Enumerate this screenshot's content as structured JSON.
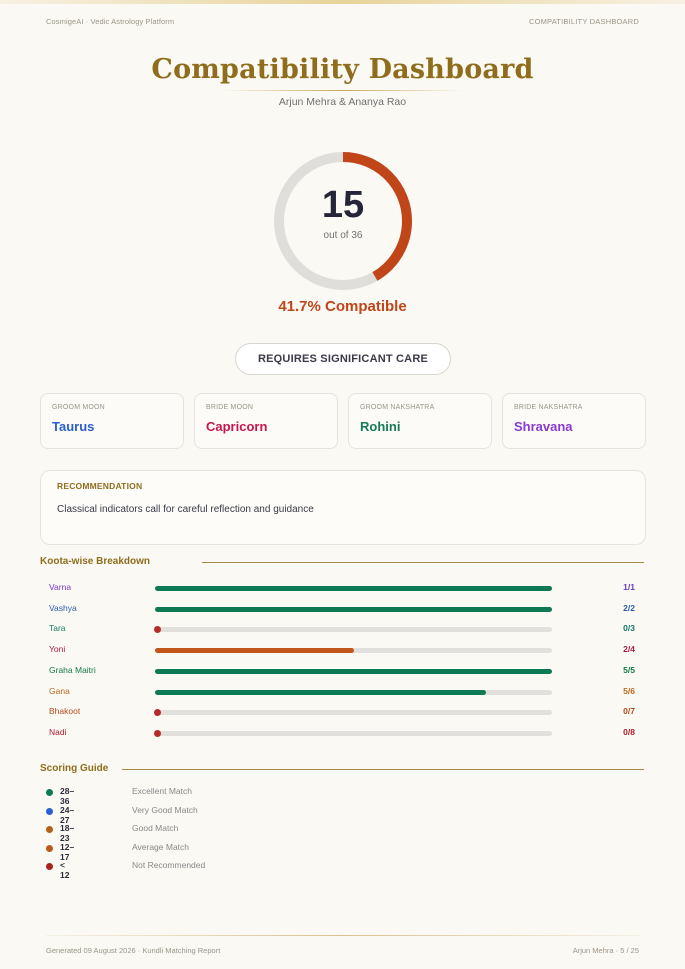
{
  "header": {
    "left": "CosmigeAI  ·  Vedic Astrology Platform",
    "right": "COMPATIBILITY DASHBOARD"
  },
  "title": "Compatibility Dashboard",
  "couple": "Arjun Mehra  &  Ananya Rao",
  "score": {
    "value": "15",
    "out_of": "out of 36",
    "fraction": 0.4167,
    "percent_label": "41.7% Compatible",
    "color": "#c0461a"
  },
  "verdict": "REQUIRES SIGNIFICANT CARE",
  "cards": [
    {
      "label": "GROOM MOON",
      "value": "Taurus",
      "color": "#2a5fd0"
    },
    {
      "label": "BRIDE MOON",
      "value": "Capricorn",
      "color": "#c8144e"
    },
    {
      "label": "GROOM NAKSHATRA",
      "value": "Rohini",
      "color": "#157a5a"
    },
    {
      "label": "BRIDE NAKSHATRA",
      "value": "Shravana",
      "color": "#8a3ad0"
    }
  ],
  "recommendation": {
    "label": "RECOMMENDATION",
    "text": "Classical indicators call for careful reflection and guidance"
  },
  "koota": {
    "title": "Koota-wise Breakdown",
    "rows": [
      {
        "name": "Varna",
        "score": "1/1",
        "fraction": 1.0,
        "name_color": "#7a3ad0",
        "score_color": "#6a3ac8",
        "bar_color": "#0d7a55"
      },
      {
        "name": "Vashya",
        "score": "2/2",
        "fraction": 1.0,
        "name_color": "#2a5fb0",
        "score_color": "#2a5fb0",
        "bar_color": "#0d7a55"
      },
      {
        "name": "Tara",
        "score": "0/3",
        "fraction": 0.0,
        "name_color": "#157a6a",
        "score_color": "#157a6a",
        "bar_color": "#b52a2a"
      },
      {
        "name": "Yoni",
        "score": "2/4",
        "fraction": 0.5,
        "name_color": "#b01a4a",
        "score_color": "#b01a4a",
        "bar_color": "#c0561a"
      },
      {
        "name": "Graha Maitri",
        "score": "5/5",
        "fraction": 1.0,
        "name_color": "#127a45",
        "score_color": "#127a45",
        "bar_color": "#0d7a55"
      },
      {
        "name": "Gana",
        "score": "5/6",
        "fraction": 0.8333,
        "name_color": "#c0661a",
        "score_color": "#c0661a",
        "bar_color": "#0d7a55"
      },
      {
        "name": "Bhakoot",
        "score": "0/7",
        "fraction": 0.0,
        "name_color": "#b54a1a",
        "score_color": "#b54a1a",
        "bar_color": "#b52a2a"
      },
      {
        "name": "Nadi",
        "score": "0/8",
        "fraction": 0.0,
        "name_color": "#b01a2a",
        "score_color": "#b01a2a",
        "bar_color": "#b52a2a"
      }
    ]
  },
  "guide": {
    "title": "Scoring Guide",
    "rows": [
      {
        "range": "28–36",
        "text": "Excellent Match",
        "color": "#0d7a55"
      },
      {
        "range": "24–27",
        "text": "Very Good Match",
        "color": "#2a5fd0"
      },
      {
        "range": "18–23",
        "text": "Good Match",
        "color": "#b5601a"
      },
      {
        "range": "12–17",
        "text": "Average Match",
        "color": "#c0561a"
      },
      {
        "range": "< 12",
        "text": "Not Recommended",
        "color": "#a82222"
      }
    ]
  },
  "footer": {
    "left": "Generated 09 August 2026  ·  Kundli Matching Report",
    "right": "Arjun Mehra  ·  5 / 25"
  }
}
